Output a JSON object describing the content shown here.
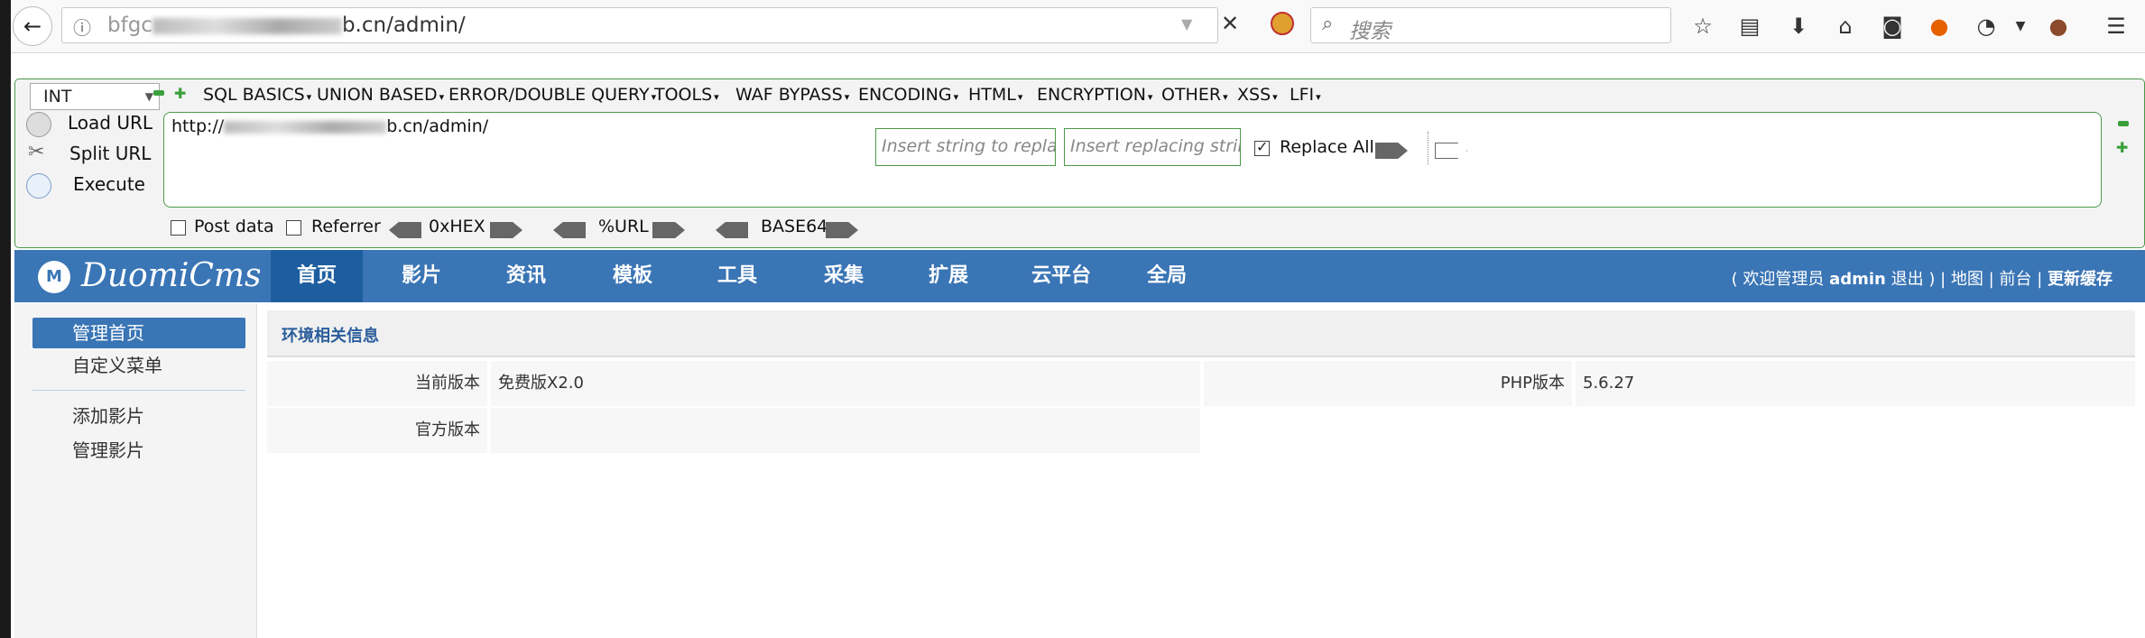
{
  "browser": {
    "url_prefix": "bfgc",
    "url_suffix": "b.cn/admin/",
    "search_placeholder": "搜索"
  },
  "hackbar": {
    "mode": "INT",
    "menus": [
      "SQL BASICS",
      "UNION BASED",
      "ERROR/DOUBLE QUERY",
      "TOOLS",
      "WAF BYPASS",
      "ENCODING",
      "HTML",
      "ENCRYPTION",
      "OTHER",
      "XSS",
      "LFI"
    ],
    "load_url": "Load URL",
    "split_url": "Split URL",
    "execute": "Execute",
    "url_prefix": "http://",
    "url_suffix": "b.cn/admin/",
    "post_data": "Post data",
    "referrer": "Referrer",
    "hex": "0xHEX",
    "percent_url": "%URL",
    "base64": "BASE64",
    "insert_placeholder": "Insert string to replace",
    "replacing_placeholder": "Insert replacing string",
    "replace_all": "Replace All"
  },
  "cms": {
    "logo": "DuomiCms",
    "nav": [
      "首页",
      "影片",
      "资讯",
      "模板",
      "工具",
      "采集",
      "扩展",
      "云平台",
      "全局"
    ],
    "welcome_prefix": "( 欢迎管理员",
    "admin_name": "admin",
    "logout": "退出 )",
    "sep": "|",
    "map": "地图",
    "front": "前台",
    "update_cache": "更新缓存",
    "sidebar": [
      "管理首页",
      "自定义菜单",
      "添加影片",
      "管理影片"
    ],
    "section_title": "环境相关信息",
    "rows": {
      "current_version_label": "当前版本",
      "current_version_value": "免费版X2.0",
      "php_label": "PHP版本",
      "php_value": "5.6.27",
      "official_label": "官方版本",
      "official_value": ""
    }
  },
  "colors": {
    "nav_blue": "#3a75b5",
    "hackbar_green": "#4a9a4a"
  }
}
